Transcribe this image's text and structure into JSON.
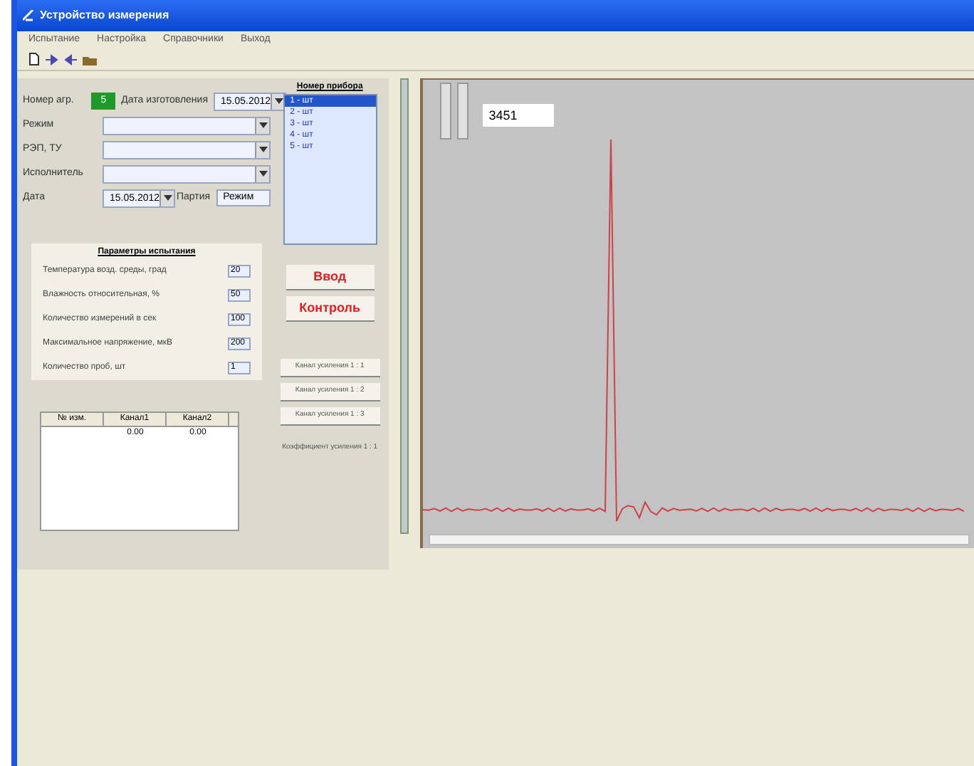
{
  "window": {
    "title": "Устройство измерения"
  },
  "menu": [
    "Испытание",
    "Настройка",
    "Справочники",
    "Выход"
  ],
  "form": {
    "fields": [
      {
        "kind": "number",
        "label": "Номер агр.",
        "value": "5",
        "date_label": "Дата изготовления",
        "date_value": "15.05.2012"
      },
      {
        "kind": "combo",
        "label": "Режим"
      },
      {
        "kind": "combo",
        "label": "РЭП, ТУ"
      },
      {
        "kind": "combo",
        "label": "Исполнитель"
      },
      {
        "kind": "date",
        "label": "Дата",
        "value": "15.05.2012",
        "extra_label": "Партия",
        "extra_value": "Режим"
      }
    ]
  },
  "channels": {
    "title": "Номер прибора",
    "items": [
      {
        "label": "1 - шт",
        "selected": true
      },
      {
        "label": "2 - шт",
        "selected": false
      },
      {
        "label": "3 - шт",
        "selected": false
      },
      {
        "label": "4 - шт",
        "selected": false
      },
      {
        "label": "5 - шт",
        "selected": false
      }
    ]
  },
  "params": {
    "title": "Параметры испытания",
    "items": [
      {
        "label": "Температура возд. среды, град",
        "value": "20"
      },
      {
        "label": "Влажность относительная, %",
        "value": "50"
      },
      {
        "label": "Количество измерений в сек",
        "value": "100"
      },
      {
        "label": "Максимальное напряжение, мкВ",
        "value": "200"
      },
      {
        "label": "Количество проб, шт",
        "value": "1"
      }
    ]
  },
  "actions": [
    "Ввод",
    "Контроль"
  ],
  "gain_buttons": [
    "Канал усиления 1 : 1",
    "Канал усиления 1 : 2",
    "Канал усиления 1 : 3"
  ],
  "gain_label": "Коэффициент усиления 1 : 1",
  "table": {
    "columns": [
      "№ изм.",
      "Канал1",
      "Канал2"
    ],
    "rows": [
      [
        "",
        "0.00",
        "0.00"
      ]
    ]
  },
  "plot": {
    "readout": "3451"
  }
}
